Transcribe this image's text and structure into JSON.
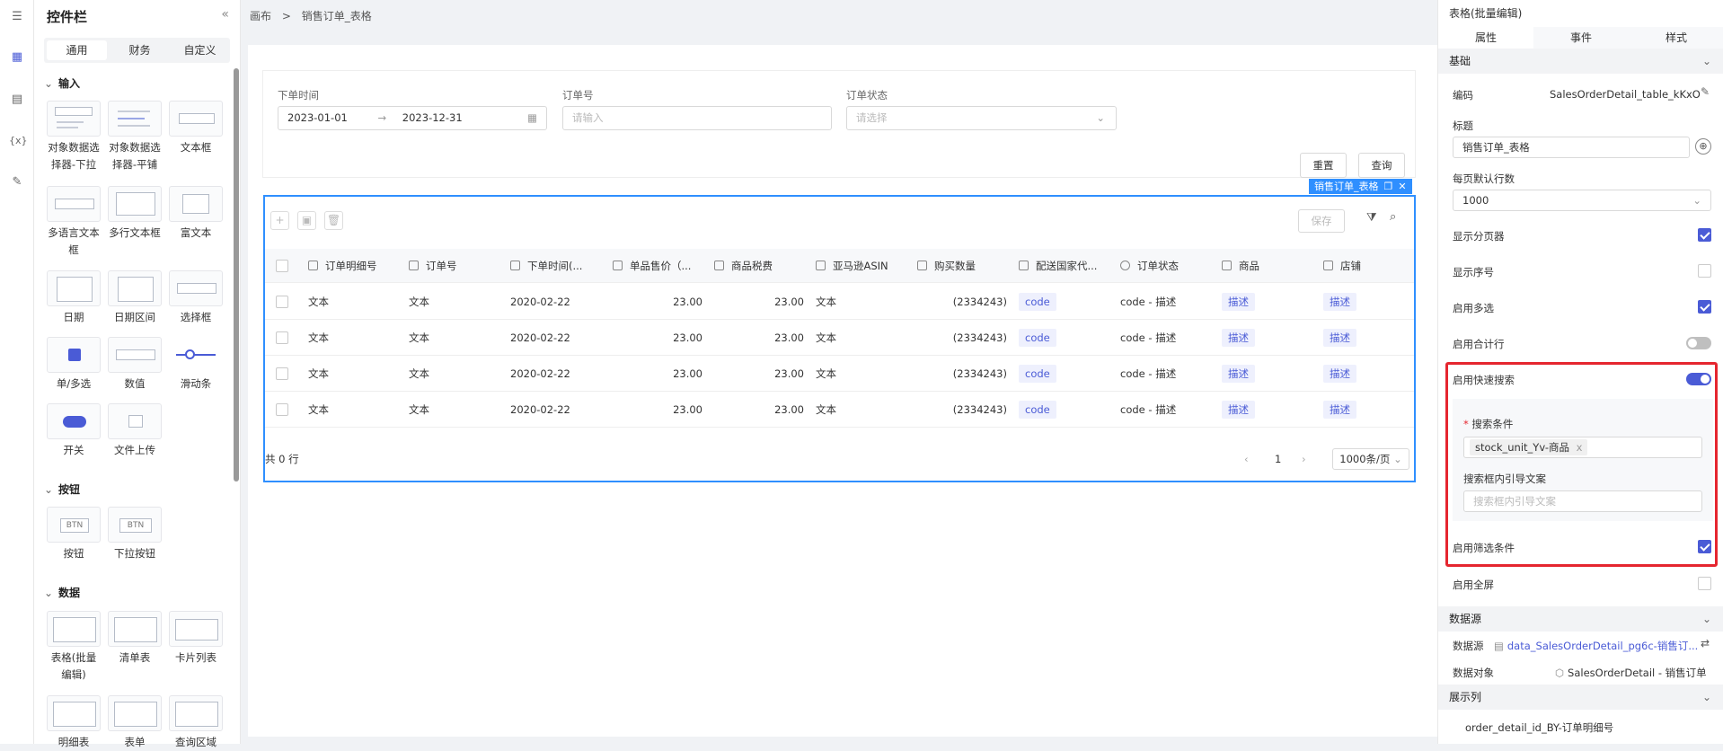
{
  "rail": {
    "icons": [
      "outline-icon",
      "widgets-icon",
      "pages-icon",
      "variables-icon",
      "settings-icon"
    ]
  },
  "widgetbar": {
    "title": "控件栏",
    "collapse": "«",
    "tabs": [
      "通用",
      "财务",
      "自定义"
    ],
    "sections": {
      "input": "输入",
      "button": "按钮",
      "data": "数据"
    },
    "input_items": [
      "对象数据选择器-下拉",
      "对象数据选择器-平铺",
      "文本框",
      "多语言文本框",
      "多行文本框",
      "富文本",
      "日期",
      "日期区间",
      "选择框",
      "单/多选",
      "数值",
      "滑动条",
      "开关",
      "文件上传"
    ],
    "button_items": [
      "按钮",
      "下拉按钮"
    ],
    "button_glyphs": [
      "BTN",
      "BTN"
    ],
    "data_items": [
      "表格(批量编辑)",
      "清单表",
      "卡片列表",
      "明细表",
      "表单",
      "查询区域"
    ]
  },
  "breadcrumb": {
    "root": "画布",
    "sep": ">",
    "current": "销售订单_表格"
  },
  "filters": {
    "date_label": "下单时间",
    "date_start": "2023-01-01",
    "date_arrow": "→",
    "date_end": "2023-12-31",
    "order_label": "订单号",
    "order_placeholder": "请输入",
    "status_label": "订单状态",
    "status_placeholder": "请选择"
  },
  "actions": {
    "reset": "重置",
    "query": "查询"
  },
  "table": {
    "tag": "销售订单_表格",
    "save": "保存",
    "columns": [
      "订单明细号",
      "订单号",
      "下单时间(...",
      "单品售价（...",
      "商品税费",
      "亚马逊ASIN",
      "购买数量",
      "配送国家代...",
      "订单状态",
      "商品",
      "店铺"
    ],
    "rows": [
      {
        "c1": "文本",
        "c2": "文本",
        "c3": "2020-02-22",
        "c4": "23.00",
        "c5": "23.00",
        "c6": "文本",
        "c7": "(2334243)",
        "c8": "code",
        "c9": "code - 描述",
        "c10": "描述",
        "c11": "描述"
      },
      {
        "c1": "文本",
        "c2": "文本",
        "c3": "2020-02-22",
        "c4": "23.00",
        "c5": "23.00",
        "c6": "文本",
        "c7": "(2334243)",
        "c8": "code",
        "c9": "code - 描述",
        "c10": "描述",
        "c11": "描述"
      },
      {
        "c1": "文本",
        "c2": "文本",
        "c3": "2020-02-22",
        "c4": "23.00",
        "c5": "23.00",
        "c6": "文本",
        "c7": "(2334243)",
        "c8": "code",
        "c9": "code - 描述",
        "c10": "描述",
        "c11": "描述"
      },
      {
        "c1": "文本",
        "c2": "文本",
        "c3": "2020-02-22",
        "c4": "23.00",
        "c5": "23.00",
        "c6": "文本",
        "c7": "(2334243)",
        "c8": "code",
        "c9": "code - 描述",
        "c10": "描述",
        "c11": "描述"
      }
    ],
    "total": "共 0 行",
    "page": "1",
    "page_size": "1000条/页"
  },
  "panel": {
    "title": "表格(批量编辑)",
    "tabs": [
      "属性",
      "事件",
      "样式"
    ],
    "basic": "基础",
    "code_label": "编码",
    "code_value": "SalesOrderDetail_table_kKxO",
    "title_label": "标题",
    "title_value": "销售订单_表格",
    "rows_label": "每页默认行数",
    "rows_value": "1000",
    "show_pager": "显示分页器",
    "show_index": "显示序号",
    "multi": "启用多选",
    "sum_row": "启用合计行",
    "quick_search": "启用快速搜索",
    "search_cond": "搜索条件",
    "required_mark": "*",
    "search_tag": "stock_unit_Yv-商品",
    "tag_close": "x",
    "guide_label": "搜索框内引导文案",
    "guide_placeholder": "搜索框内引导文案",
    "filter_cond": "启用筛选条件",
    "fullscreen": "启用全屏",
    "datasource": "数据源",
    "ds_label": "数据源",
    "ds_value": "data_SalesOrderDetail_pg6c-销售订...",
    "obj_label": "数据对象",
    "obj_value": "SalesOrderDetail - 销售订单",
    "display_cols": "展示列",
    "col1": "order_detail_id_BY-订单明细号"
  },
  "colors": {
    "accent": "#4a5bd6",
    "selection": "#2f8fff",
    "highlight": "#e5262f"
  }
}
